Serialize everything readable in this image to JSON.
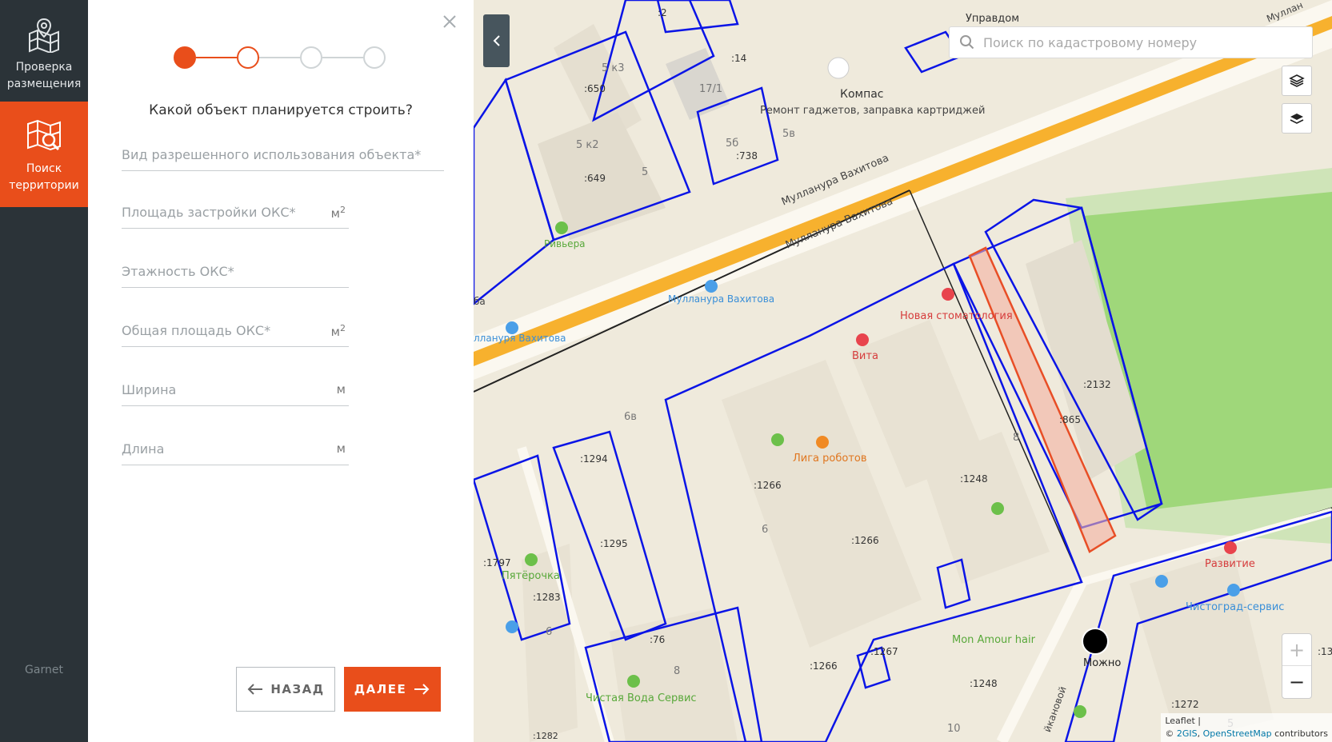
{
  "sidebar": {
    "items": [
      {
        "label": "Проверка\nразмещения",
        "icon": "map-pin-grid-icon"
      },
      {
        "label": "Поиск\nтерритории",
        "icon": "map-search-icon"
      }
    ],
    "brand": "Garnet"
  },
  "wizard": {
    "current_step": 2,
    "total_steps": 4,
    "question": "Какой объект планируется строить?",
    "fields": {
      "usage_type": {
        "placeholder": "Вид разрешенного использования объекта*"
      },
      "building_area": {
        "placeholder": "Площадь застройки ОКС*",
        "unit": "м",
        "unit_sup": "2"
      },
      "floors": {
        "placeholder": "Этажность ОКС*"
      },
      "total_area": {
        "placeholder": "Общая площадь ОКС*",
        "unit": "м",
        "unit_sup": "2"
      },
      "width": {
        "placeholder": "Ширина",
        "unit": "м"
      },
      "length": {
        "placeholder": "Длина",
        "unit": "м"
      }
    },
    "back_label": "НАЗАД",
    "next_label": "ДАЛЕЕ"
  },
  "map": {
    "search_placeholder": "Поиск по кадастровому номеру",
    "attribution": {
      "leaflet": "Leaflet",
      "sep": " | ",
      "copy": "© ",
      "gis": "2GIS",
      "comma": ", ",
      "osm": "OpenStreetMap",
      "contrib": " contributors"
    },
    "labels": {
      "upravdom": "Управдом",
      "kompas": "Компас",
      "kompas_desc": "Ремонт гаджетов, заправка картриджей",
      "street1": "Мулланура Вахитова",
      "street2": "Мулланура Вахитова",
      "stop1": "Мулланура Вахитова",
      "stop2": "ллануря Вахитова",
      "stop2_prefix": "ба",
      "rivera": "Ривьера",
      "dentist": "Новая стоматология",
      "vita": "Вита",
      "liga": "Лига роботов",
      "pyaterochka": "Пятёрочка",
      "chistaya": "Чистая Вода Сервис",
      "monamour": "Mon Amour hair",
      "mozhno": "Можно",
      "razvitie": "Развитие",
      "chistograd": "Чистоград-сервис",
      "street3": "йкановой",
      "street4": "Муллан"
    },
    "parcels": [
      ":2",
      ":14",
      ":650",
      ":649",
      ":738",
      ":1294",
      ":1295",
      ":1797",
      ":1283",
      ":1282",
      ":76",
      ":1266",
      ":1266",
      ":1266",
      ":1267",
      ":1248",
      ":1248",
      ":2132",
      ":865",
      ":1272",
      ":13"
    ],
    "houses": [
      "5 к3",
      "17/1",
      "5 к2",
      "5",
      "5б",
      "5в",
      "6в",
      "6",
      "6",
      "8",
      "8",
      "10",
      "5"
    ],
    "colors": {
      "accent": "#e94e1b",
      "sidebar": "#2b3338",
      "parcel": "#0a14e6",
      "highlight": "#e84e26",
      "road": "#f7b12e",
      "park": "#9fd77a"
    }
  }
}
